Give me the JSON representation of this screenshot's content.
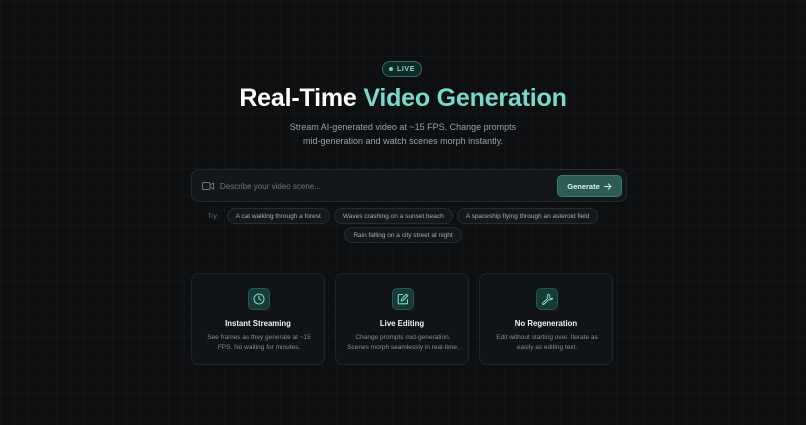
{
  "badge": {
    "label": "LIVE"
  },
  "hero": {
    "title_main": "Real-Time ",
    "title_accent": "Video Generation",
    "subtitle": "Stream AI-generated video at ~15 FPS. Change prompts mid-generation and watch scenes morph instantly."
  },
  "prompt": {
    "placeholder": "Describe your video scene...",
    "value": "",
    "button_label": "Generate"
  },
  "suggestions": {
    "label": "Try:",
    "row1": [
      "A cat walking through a forest",
      "Waves crashing on a sunset beach",
      "A spaceship flying through an asteroid field"
    ],
    "row2": [
      "Rain falling on a city street at night"
    ]
  },
  "features": [
    {
      "icon": "clock-icon",
      "title": "Instant Streaming",
      "desc": "See frames as they generate at ~15 FPS. No waiting for minutes."
    },
    {
      "icon": "edit-icon",
      "title": "Live Editing",
      "desc": "Change prompts mid-generation. Scenes morph seamlessly in real-time."
    },
    {
      "icon": "wrench-icon",
      "title": "No Regeneration",
      "desc": "Edit without starting over. Iterate as easily as editing text."
    }
  ],
  "colors": {
    "accent": "#7ad9c9",
    "background": "#0d0f11",
    "button": "#2c5c56"
  }
}
